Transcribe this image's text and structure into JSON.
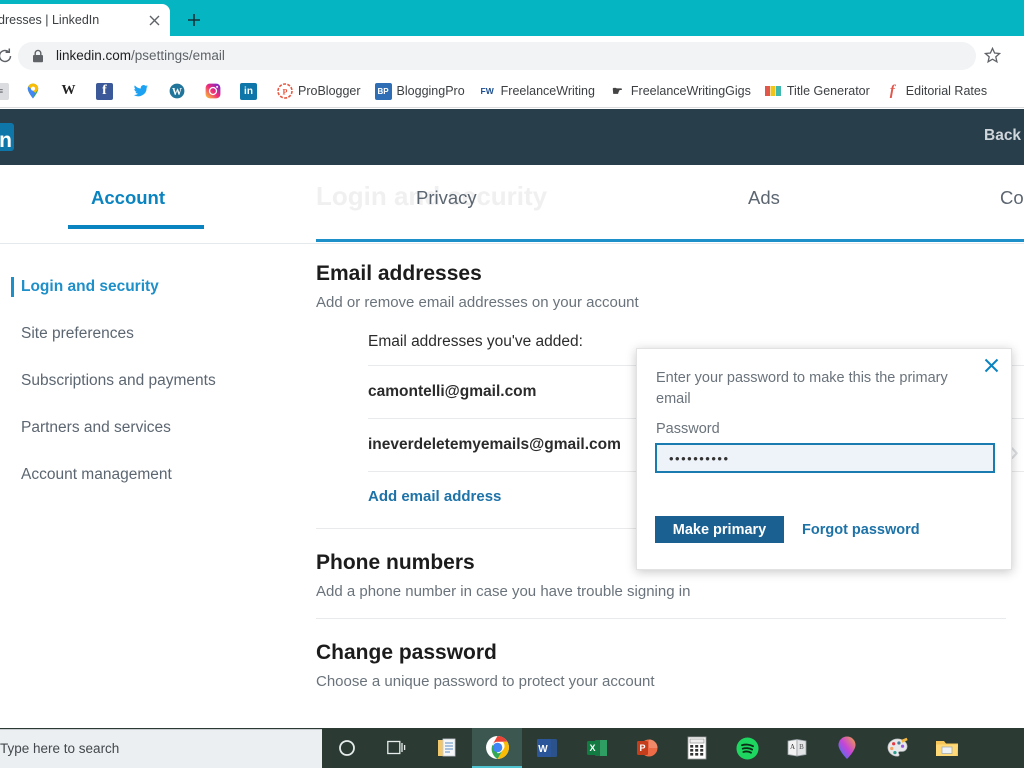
{
  "browser": {
    "tab": {
      "title": "dresses | LinkedIn",
      "close_icon": "close-icon"
    },
    "new_tab_icon": "plus-icon",
    "reload_icon": "reload-icon",
    "lock_icon": "lock-icon",
    "star_icon": "star-icon",
    "url": {
      "domain": "linkedin.com",
      "path": "/psettings/email"
    },
    "bookmarks": [
      {
        "label": "",
        "icon": "app-icon"
      },
      {
        "label": "",
        "icon": "google-maps-icon"
      },
      {
        "label": "",
        "icon": "wikipedia-icon"
      },
      {
        "label": "",
        "icon": "facebook-icon"
      },
      {
        "label": "",
        "icon": "twitter-icon"
      },
      {
        "label": "",
        "icon": "wordpress-icon"
      },
      {
        "label": "",
        "icon": "instagram-icon"
      },
      {
        "label": "",
        "icon": "linkedin-icon"
      },
      {
        "label": "ProBlogger",
        "icon": "problogger-icon"
      },
      {
        "label": "BloggingPro",
        "icon": "bloggingpro-icon"
      },
      {
        "label": "FreelanceWriting",
        "icon": "freelancewriting-icon"
      },
      {
        "label": "FreelanceWritingGigs",
        "icon": "freelancewritinggigs-icon"
      },
      {
        "label": "Title Generator",
        "icon": "title-generator-icon"
      },
      {
        "label": "Editorial Rates",
        "icon": "editorial-rates-icon"
      }
    ]
  },
  "linkedin": {
    "logo_text": "in",
    "back_to_label": "Back to",
    "ghost_heading": "Login and security",
    "tabs": [
      {
        "label": "Account",
        "active": true
      },
      {
        "label": "Privacy",
        "active": false
      },
      {
        "label": "Ads",
        "active": false
      },
      {
        "label": "Co",
        "active": false
      }
    ],
    "sidebar": {
      "items": [
        {
          "label": "Login and security",
          "active": true
        },
        {
          "label": "Site preferences",
          "active": false
        },
        {
          "label": "Subscriptions and payments",
          "active": false
        },
        {
          "label": "Partners and services",
          "active": false
        },
        {
          "label": "Account management",
          "active": false
        }
      ]
    },
    "sections": {
      "email": {
        "title": "Email addresses",
        "subtitle": "Add or remove email addresses on your account",
        "list_label": "Email addresses you've added:",
        "emails": [
          "camontelli@gmail.com",
          "ineverdeletemyemails@gmail.com"
        ],
        "add_link": "Add email address"
      },
      "phone": {
        "title": "Phone numbers",
        "subtitle": "Add a phone number in case you have trouble signing in"
      },
      "password": {
        "title": "Change password",
        "subtitle": "Choose a unique password to protect your account"
      }
    },
    "popup": {
      "message": "Enter your password to make this the primary email",
      "password_label": "Password",
      "password_value": "••••••••••",
      "primary_button": "Make primary",
      "forgot_link": "Forgot password",
      "close_icon": "close-icon"
    },
    "colors": {
      "brand_blue": "#0a84c1",
      "header_navy": "#283e4a",
      "link_blue": "#1d72a8",
      "button_blue": "#1a6192"
    }
  },
  "taskbar": {
    "search_placeholder": "Type here to search",
    "icons": [
      {
        "name": "cortana-icon"
      },
      {
        "name": "task-view-icon"
      },
      {
        "name": "sticky-notes-icon"
      },
      {
        "name": "chrome-icon"
      },
      {
        "name": "word-icon"
      },
      {
        "name": "excel-icon"
      },
      {
        "name": "powerpoint-icon"
      },
      {
        "name": "calculator-icon"
      },
      {
        "name": "spotify-icon"
      },
      {
        "name": "dictionary-icon"
      },
      {
        "name": "photos-icon"
      },
      {
        "name": "paint-icon"
      },
      {
        "name": "file-explorer-icon"
      }
    ]
  }
}
